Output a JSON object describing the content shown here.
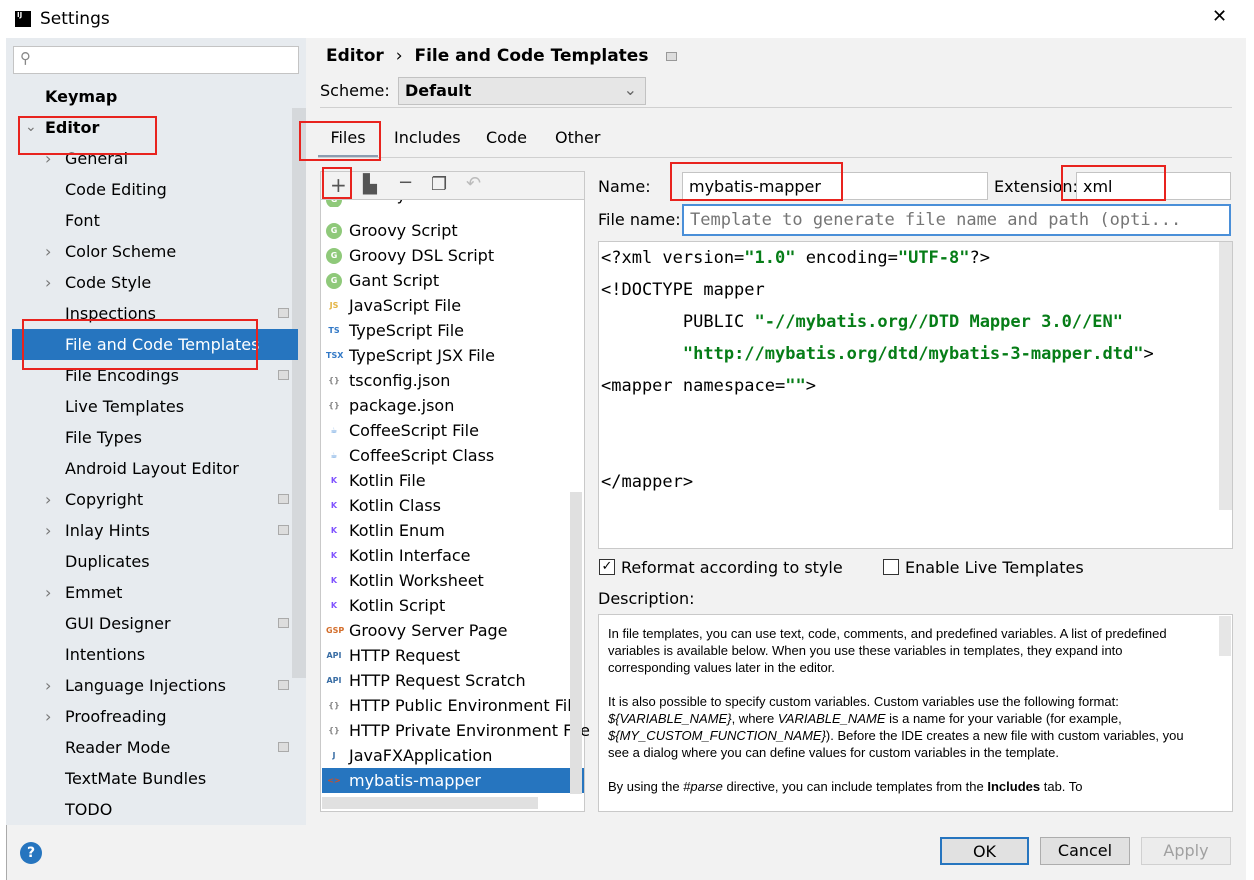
{
  "window": {
    "title": "Settings"
  },
  "search": {
    "placeholder": ""
  },
  "sidebar": {
    "items": [
      {
        "label": "Keymap",
        "bold": true,
        "level": 0
      },
      {
        "label": "Editor",
        "bold": true,
        "level": 0,
        "arrow": "down"
      },
      {
        "label": "General",
        "level": 1,
        "arrow": "right"
      },
      {
        "label": "Code Editing",
        "level": 1
      },
      {
        "label": "Font",
        "level": 1
      },
      {
        "label": "Color Scheme",
        "level": 1,
        "arrow": "right"
      },
      {
        "label": "Code Style",
        "level": 1,
        "arrow": "right"
      },
      {
        "label": "Inspections",
        "level": 1,
        "cfg": true
      },
      {
        "label": "File and Code Templates",
        "level": 1,
        "selected": true
      },
      {
        "label": "File Encodings",
        "level": 1,
        "cfg": true
      },
      {
        "label": "Live Templates",
        "level": 1
      },
      {
        "label": "File Types",
        "level": 1
      },
      {
        "label": "Android Layout Editor",
        "level": 1
      },
      {
        "label": "Copyright",
        "level": 1,
        "arrow": "right",
        "cfg": true
      },
      {
        "label": "Inlay Hints",
        "level": 1,
        "arrow": "right",
        "cfg": true
      },
      {
        "label": "Duplicates",
        "level": 1
      },
      {
        "label": "Emmet",
        "level": 1,
        "arrow": "right"
      },
      {
        "label": "GUI Designer",
        "level": 1,
        "cfg": true
      },
      {
        "label": "Intentions",
        "level": 1
      },
      {
        "label": "Language Injections",
        "level": 1,
        "arrow": "right",
        "cfg": true
      },
      {
        "label": "Proofreading",
        "level": 1,
        "arrow": "right"
      },
      {
        "label": "Reader Mode",
        "level": 1,
        "cfg": true
      },
      {
        "label": "TextMate Bundles",
        "level": 1
      },
      {
        "label": "TODO",
        "level": 1
      }
    ]
  },
  "breadcrumb": {
    "parent": "Editor",
    "separator": "›",
    "current": "File and Code Templates"
  },
  "scheme": {
    "label": "Scheme:",
    "value": "Default"
  },
  "tabs": [
    "Files",
    "Includes",
    "Code",
    "Other"
  ],
  "active_tab": "Files",
  "templates": [
    {
      "label": "Groovy Annotation",
      "icon": "G"
    },
    {
      "label": "Groovy Script",
      "icon": "G"
    },
    {
      "label": "Groovy DSL Script",
      "icon": "G"
    },
    {
      "label": "Gant Script",
      "icon": "G"
    },
    {
      "label": "JavaScript File",
      "icon": "JS"
    },
    {
      "label": "TypeScript File",
      "icon": "TS"
    },
    {
      "label": "TypeScript JSX File",
      "icon": "TSX"
    },
    {
      "label": "tsconfig.json",
      "icon": "{}"
    },
    {
      "label": "package.json",
      "icon": "{}"
    },
    {
      "label": "CoffeeScript File",
      "icon": "☕"
    },
    {
      "label": "CoffeeScript Class",
      "icon": "☕"
    },
    {
      "label": "Kotlin File",
      "icon": "K"
    },
    {
      "label": "Kotlin Class",
      "icon": "K"
    },
    {
      "label": "Kotlin Enum",
      "icon": "K"
    },
    {
      "label": "Kotlin Interface",
      "icon": "K"
    },
    {
      "label": "Kotlin Worksheet",
      "icon": "K"
    },
    {
      "label": "Kotlin Script",
      "icon": "K"
    },
    {
      "label": "Groovy Server Page",
      "icon": "GSP"
    },
    {
      "label": "HTTP Request",
      "icon": "API"
    },
    {
      "label": "HTTP Request Scratch",
      "icon": "API"
    },
    {
      "label": "HTTP Public Environment File",
      "icon": "{}"
    },
    {
      "label": "HTTP Private Environment File",
      "icon": "{}"
    },
    {
      "label": "JavaFXApplication",
      "icon": "J"
    },
    {
      "label": "mybatis-mapper",
      "icon": "<>",
      "selected": true
    }
  ],
  "form": {
    "name_label": "Name:",
    "name_value": "mybatis-mapper",
    "ext_label": "Extension:",
    "ext_value": "xml",
    "filename_label": "File name:",
    "filename_placeholder": "Template to generate file name and path (opti..."
  },
  "code": {
    "l1a": "<?xml version=",
    "l1b": "\"1.0\"",
    "l1c": " encoding=",
    "l1d": "\"UTF-8\"",
    "l1e": "?>",
    "l2": "<!DOCTYPE mapper",
    "l3a": "        PUBLIC ",
    "l3b": "\"-//mybatis.org//DTD Mapper 3.0//EN\"",
    "l4a": "        ",
    "l4b": "\"http://mybatis.org/dtd/mybatis-3-mapper.dtd\"",
    "l4c": ">",
    "l5a": "<mapper namespace=",
    "l5b": "\"\"",
    "l5c": ">",
    "l6": "</mapper>"
  },
  "options": {
    "reformat": "Reformat according to style",
    "reformat_checked": true,
    "live": "Enable Live Templates",
    "live_checked": false
  },
  "description": {
    "label": "Description:",
    "p1": "In file templates, you can use text, code, comments, and predefined variables. A list of predefined variables is available below. When you use these variables in templates, they expand into corresponding values later in the editor.",
    "p2a": "It is also possible to specify custom variables. Custom variables use the following format: ",
    "p2b": "${VARIABLE_NAME}",
    "p2c": ", where ",
    "p2d": "VARIABLE_NAME",
    "p2e": " is a name for your variable (for example, ",
    "p2f": "${MY_CUSTOM_FUNCTION_NAME}",
    "p2g": "). Before the IDE creates a new file with custom variables, you see a dialog where you can define values for custom variables in the template.",
    "p3a": "By using the ",
    "p3b": "#parse",
    "p3c": " directive, you can include templates from the ",
    "p3d": "Includes",
    "p3e": " tab. To"
  },
  "buttons": {
    "ok": "OK",
    "cancel": "Cancel",
    "apply": "Apply",
    "help": "?"
  },
  "colors": {
    "selection": "#2675bf",
    "highlight": "#e8231e",
    "string": "#067d17"
  }
}
